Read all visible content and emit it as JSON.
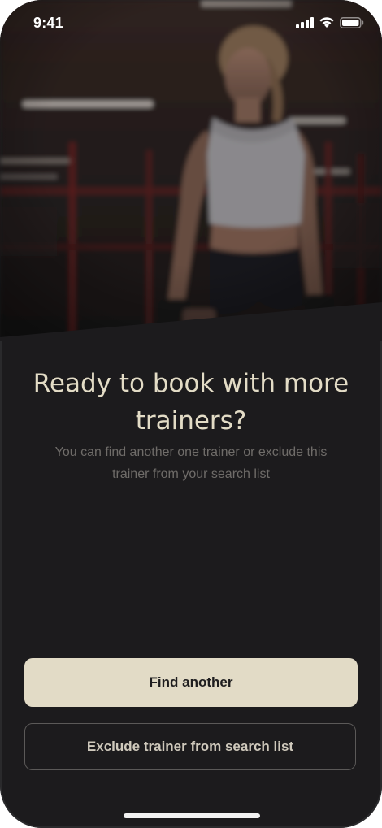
{
  "status_bar": {
    "time": "9:41",
    "icons": [
      "cellular-signal-icon",
      "wifi-icon",
      "battery-icon"
    ]
  },
  "hero": {
    "image": "photo-fitness-trainer-in-gym"
  },
  "content": {
    "title": "Ready to book with more trainers?",
    "subtitle": "You can find another one trainer or exclude this trainer from your search list"
  },
  "actions": {
    "primary_label": "Find another",
    "secondary_label": "Exclude trainer from search list"
  },
  "colors": {
    "background": "#1c1b1d",
    "accent": "#e2dbc6",
    "title_text": "#e3dcc6",
    "muted_text": "#6f6c69",
    "outline": "#5b5958"
  }
}
